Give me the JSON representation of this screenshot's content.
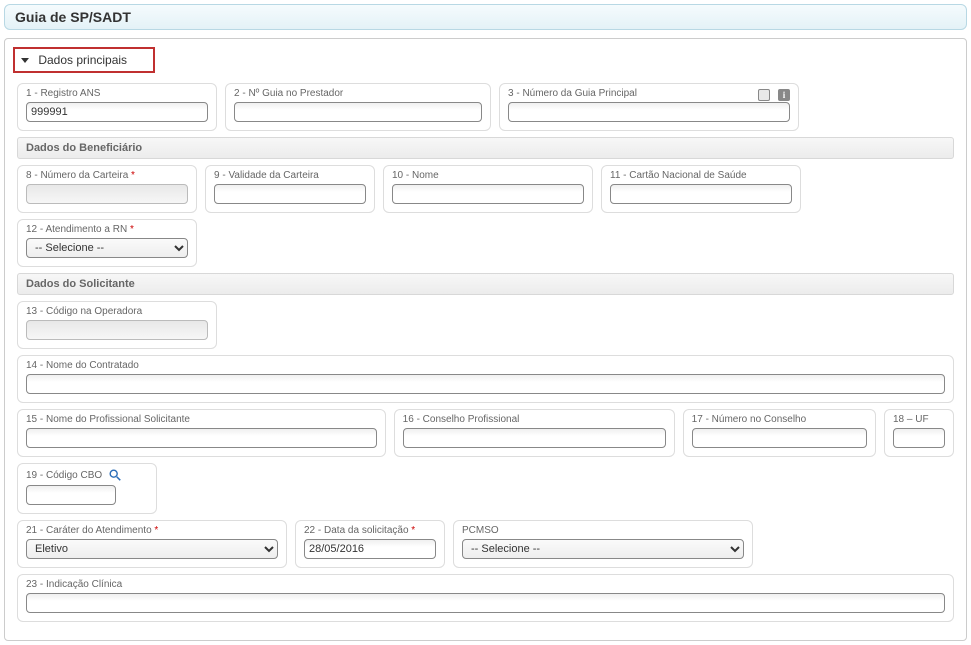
{
  "header": {
    "title": "Guia de SP/SADT"
  },
  "section": {
    "title": "Dados principais"
  },
  "fields": {
    "f1": {
      "label": "1 - Registro ANS",
      "value": "999991"
    },
    "f2": {
      "label": "2 - Nº Guia no Prestador",
      "value": ""
    },
    "f3": {
      "label": "3 - Número da Guia Principal",
      "value": ""
    },
    "sub_beneficiario": "Dados do Beneficiário",
    "f8": {
      "label": "8 - Número da Carteira",
      "value": ""
    },
    "f9": {
      "label": "9 - Validade da Carteira",
      "value": ""
    },
    "f10": {
      "label": "10 - Nome",
      "value": ""
    },
    "f11": {
      "label": "11 - Cartão Nacional de Saúde",
      "value": ""
    },
    "f12": {
      "label": "12 - Atendimento a RN",
      "selected": "-- Selecione --"
    },
    "sub_solicitante": "Dados do Solicitante",
    "f13": {
      "label": "13 - Código na Operadora",
      "value": ""
    },
    "f14": {
      "label": "14 - Nome do Contratado",
      "value": ""
    },
    "f15": {
      "label": "15 - Nome do Profissional Solicitante",
      "value": ""
    },
    "f16": {
      "label": "16 - Conselho Profissional",
      "value": ""
    },
    "f17": {
      "label": "17 - Número no Conselho",
      "value": ""
    },
    "f18": {
      "label": "18 – UF",
      "value": ""
    },
    "f19": {
      "label": "19 - Código CBO",
      "value": ""
    },
    "f21": {
      "label": "21 - Caráter do Atendimento",
      "selected": "Eletivo"
    },
    "f22": {
      "label": "22 - Data da solicitação",
      "value": "28/05/2016"
    },
    "pcmso": {
      "label": "PCMSO",
      "selected": "-- Selecione --"
    },
    "f23": {
      "label": "23 - Indicação Clínica",
      "value": ""
    }
  }
}
